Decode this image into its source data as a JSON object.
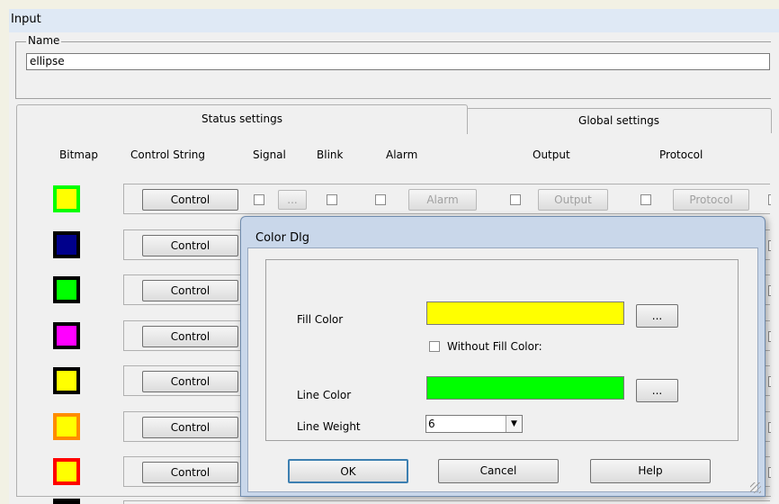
{
  "window": {
    "title": "Input"
  },
  "name_group": {
    "legend": "Name",
    "value": "ellipse"
  },
  "tabs": [
    {
      "label": "Status settings"
    },
    {
      "label": "Global settings"
    }
  ],
  "columns": {
    "bitmap": "Bitmap",
    "control_string": "Control String",
    "signal": "Signal",
    "blink": "Blink",
    "alarm": "Alarm",
    "output": "Output",
    "protocol": "Protocol"
  },
  "rows": [
    {
      "bitmap_fill": "#ffff00",
      "bitmap_border": "#00ff00",
      "control_label": "Control",
      "signal_button": "...",
      "alarm_button": "Alarm",
      "output_button": "Output",
      "protocol_button": "Protocol"
    },
    {
      "bitmap_fill": "#00008b",
      "bitmap_border": "#000000",
      "control_label": "Control"
    },
    {
      "bitmap_fill": "#00ff00",
      "bitmap_border": "#000000",
      "control_label": "Control"
    },
    {
      "bitmap_fill": "#ff00ff",
      "bitmap_border": "#000000",
      "control_label": "Control"
    },
    {
      "bitmap_fill": "#ffff00",
      "bitmap_border": "#000000",
      "control_label": "Control"
    },
    {
      "bitmap_fill": "#ffff00",
      "bitmap_border": "#ff8c00",
      "control_label": "Control"
    },
    {
      "bitmap_fill": "#ffff00",
      "bitmap_border": "#ff0000",
      "control_label": "Control"
    }
  ],
  "dialog": {
    "title": "Color Dlg",
    "fill_color_label": "Fill Color",
    "fill_color": "#ffff00",
    "fill_more": "...",
    "without_fill_label": "Without Fill Color:",
    "line_color_label": "Line Color",
    "line_color": "#00ff00",
    "line_more": "...",
    "line_weight_label": "Line Weight",
    "line_weight_value": "6",
    "ok": "OK",
    "cancel": "Cancel",
    "help": "Help"
  }
}
